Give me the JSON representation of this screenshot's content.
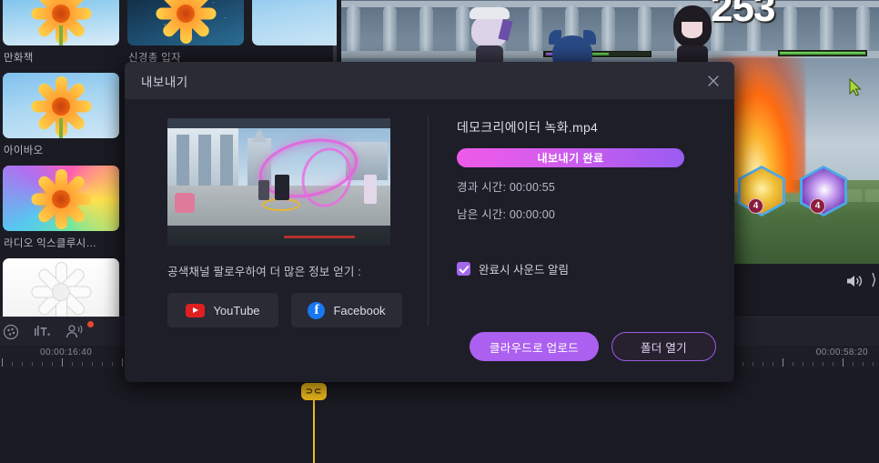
{
  "editor": {
    "library": {
      "columns": [
        {
          "items": [
            {
              "label": "만화책",
              "style": "toon"
            },
            {
              "label": "아이바오",
              "style": "sky"
            },
            {
              "label": "라디오 익스클루시…",
              "style": "rainbow"
            },
            {
              "label": "",
              "style": "sketch"
            }
          ]
        },
        {
          "items": [
            {
              "label": "신경총 입자",
              "style": "neuro"
            },
            {
              "label": "",
              "style": "sky"
            }
          ]
        },
        {
          "items": [
            {
              "label": "",
              "style": "sky"
            }
          ]
        }
      ]
    },
    "preview": {
      "combo_number": "253",
      "skill_cost_1": "4",
      "skill_cost_2": "4"
    },
    "toolbar": {
      "icons": [
        "color-wheel-icon",
        "text-tool-icon",
        "speaker-person-icon"
      ],
      "volume_icon": "volume-icon"
    },
    "timeline": {
      "time_left": "00:00:16:40",
      "time_right": "00:00:58:20",
      "playhead_label": "⊃⊂"
    }
  },
  "dialog": {
    "title": "내보내기",
    "close_icon": "close-icon",
    "share_prompt": "공색채널 팔로우하여 더 많은 정보 얻기 :",
    "share_buttons": [
      {
        "label": "YouTube",
        "icon": "youtube-icon"
      },
      {
        "label": "Facebook",
        "icon": "facebook-icon"
      }
    ],
    "file_name": "데모크리에이터 녹화.mp4",
    "progress_label": "내보내기 완료",
    "progress_percent": 100,
    "elapsed": "경과 시간: 00:00:55",
    "remaining": "남은 시간: 00:00:00",
    "sound_checkbox": {
      "label": "완료시 사운드 알림",
      "checked": true
    },
    "actions": {
      "upload": "클라우드로 업로드",
      "open_folder": "폴더 열기"
    },
    "colors": {
      "accent": "#ac60f0",
      "progress_start": "#ef5ae8",
      "progress_end": "#9a5cf2",
      "checkbox": "#a468ef"
    }
  }
}
